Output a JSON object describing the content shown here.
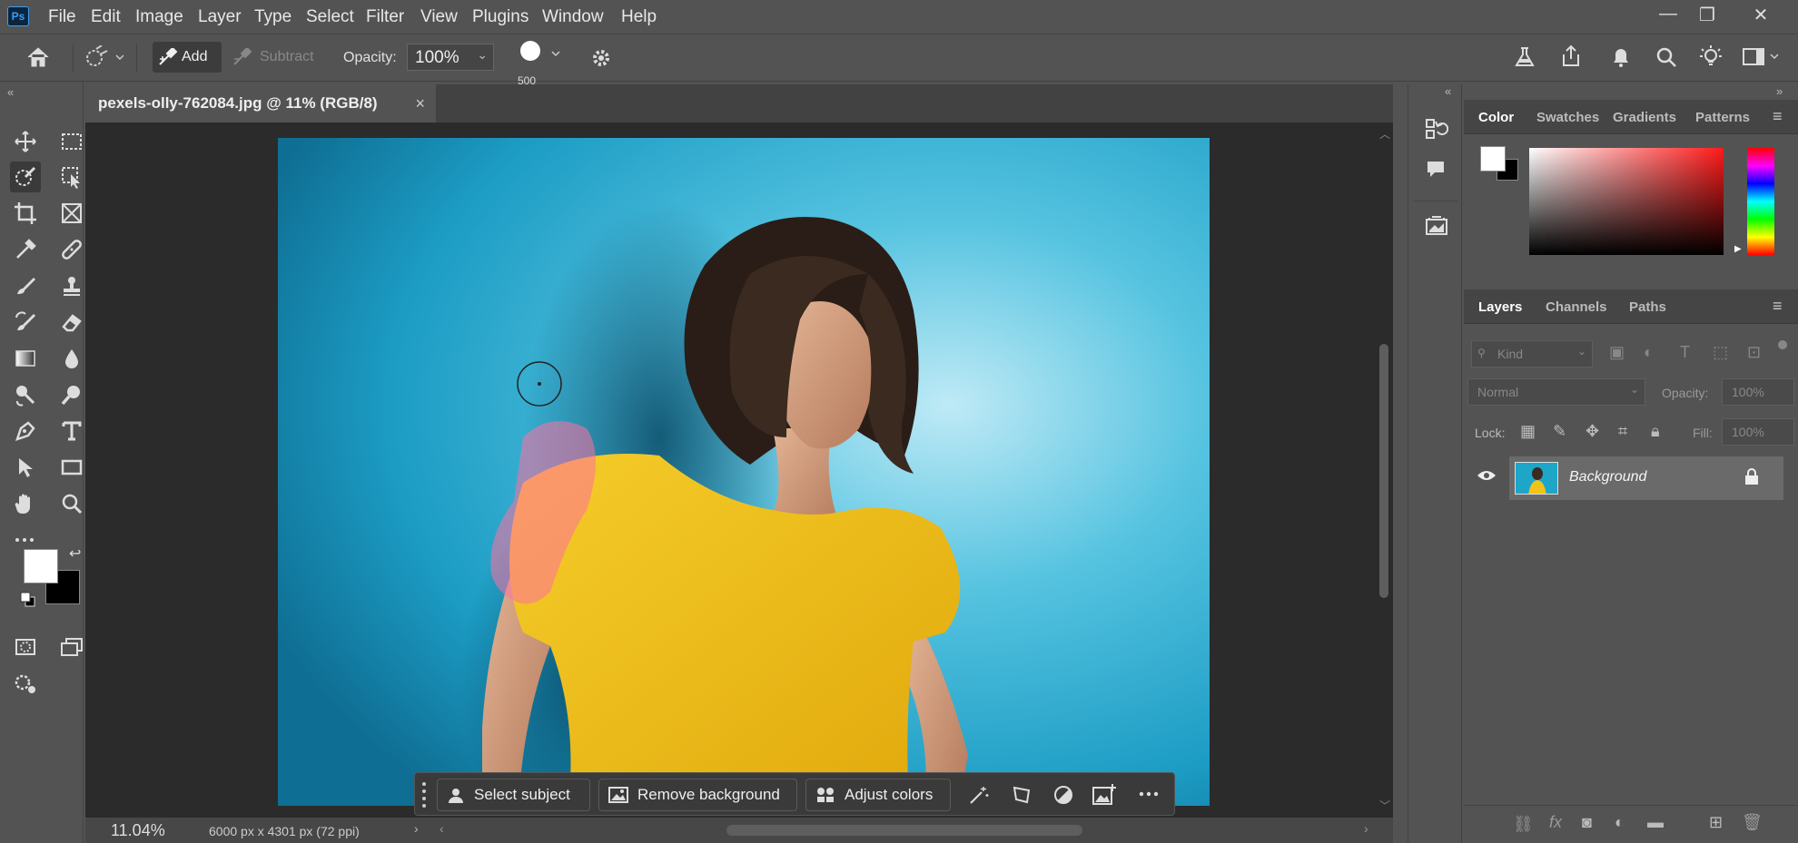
{
  "app": {
    "logo": "Ps"
  },
  "menu": [
    "File",
    "Edit",
    "Image",
    "Layer",
    "Type",
    "Select",
    "Filter",
    "View",
    "Plugins",
    "Window",
    "Help"
  ],
  "options_bar": {
    "add_label": "Add",
    "subtract_label": "Subtract",
    "opacity_label": "Opacity:",
    "opacity_value": "100%",
    "brush_size": "500"
  },
  "document": {
    "tab_title": "pexels-olly-762084.jpg @ 11% (RGB/8)",
    "tab_close": "×",
    "zoom": "11.04%",
    "dimensions": "6000 px x 4301 px (72 ppi)"
  },
  "taskbar": {
    "select_subject": "Select subject",
    "remove_background": "Remove background",
    "adjust_colors": "Adjust colors"
  },
  "color_panel": {
    "tabs": [
      "Color",
      "Swatches",
      "Gradients",
      "Patterns"
    ],
    "active_tab": "Color"
  },
  "layers_panel": {
    "tabs": [
      "Layers",
      "Channels",
      "Paths"
    ],
    "active_tab": "Layers",
    "kind_placeholder": "Kind",
    "blend_mode": "Normal",
    "opacity_label": "Opacity:",
    "opacity_value": "100%",
    "lock_label": "Lock:",
    "fill_label": "Fill:",
    "fill_value": "100%",
    "layers": [
      {
        "name": "Background",
        "visible": true,
        "locked": true
      }
    ]
  },
  "colors": {
    "foreground": "#ffffff",
    "background": "#000000",
    "photo_wall": "#1ea6c8",
    "tshirt": "#f0c21a",
    "brush_overlay": "#ff6fa0"
  }
}
